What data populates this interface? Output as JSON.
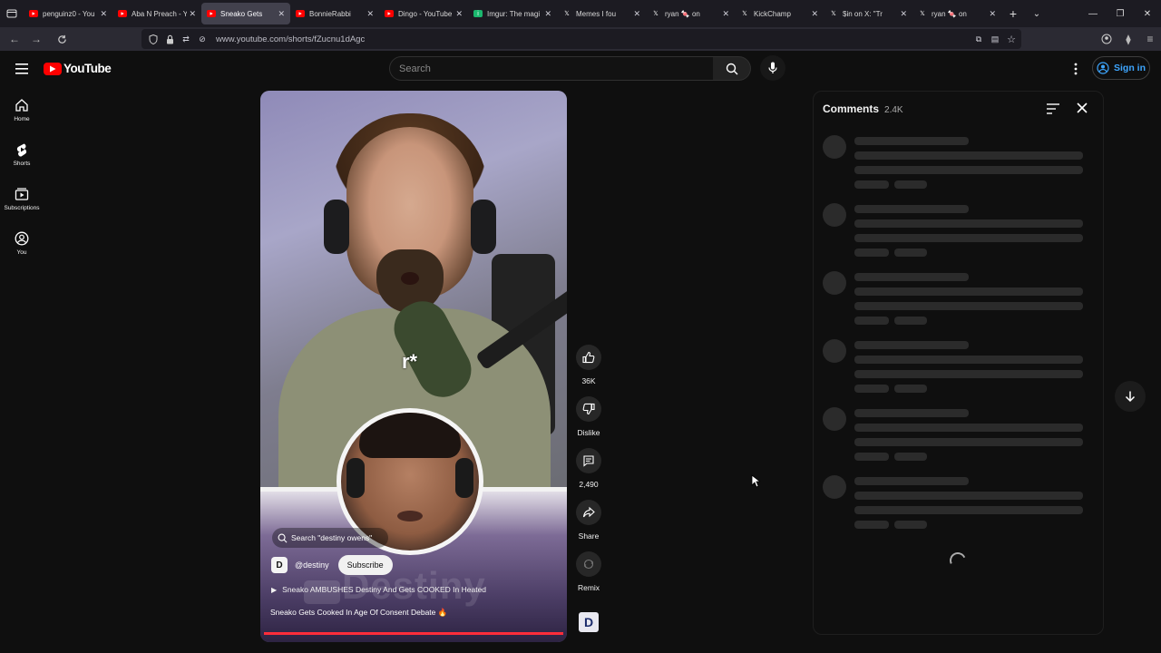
{
  "browser": {
    "tabs": [
      {
        "title": "penguinz0 - You",
        "fav": "yt",
        "active": false
      },
      {
        "title": "Aba N Preach - Y",
        "fav": "yt",
        "active": false
      },
      {
        "title": "Sneako Gets",
        "fav": "yt",
        "active": true
      },
      {
        "title": "BonnieRabbi",
        "fav": "yt",
        "active": false
      },
      {
        "title": "Dingo - YouTube",
        "fav": "yt",
        "active": false
      },
      {
        "title": "Imgur: The magi",
        "fav": "imgur",
        "active": false
      },
      {
        "title": "Memes I fou",
        "fav": "x",
        "active": false
      },
      {
        "title": "ryan 🍬 on",
        "fav": "x",
        "active": false
      },
      {
        "title": "KickChamp",
        "fav": "x",
        "active": false
      },
      {
        "title": "$in on X: \"Tr",
        "fav": "x",
        "active": false
      },
      {
        "title": "ryan 🍬 on",
        "fav": "x",
        "active": false
      }
    ],
    "url": "www.youtube.com/shorts/fZucnu1dAgc"
  },
  "header": {
    "logo_text": "YouTube",
    "search_placeholder": "Search",
    "signin_label": "Sign in"
  },
  "sidenav": [
    {
      "label": "Home",
      "icon": "home-icon"
    },
    {
      "label": "Shorts",
      "icon": "shorts-icon"
    },
    {
      "label": "Subscriptions",
      "icon": "subscriptions-icon"
    },
    {
      "label": "You",
      "icon": "you-icon"
    }
  ],
  "video": {
    "search_pill": "Search \"destiny owens\"",
    "channel": "@destiny",
    "subscribe_label": "Subscribe",
    "suggestion": "Sneako AMBUSHES Destiny And Gets COOKED In Heated",
    "title": "Sneako Gets Cooked In Age Of Consent Debate 🔥",
    "watermark": "Destiny",
    "progress_percent": 100
  },
  "actions": {
    "like_count": "36K",
    "dislike_label": "Dislike",
    "comments_count": "2,490",
    "share_label": "Share",
    "remix_label": "Remix"
  },
  "comments": {
    "title": "Comments",
    "count": "2.4K"
  },
  "colors": {
    "yt_red": "#ff0000",
    "link_blue": "#3ea6ff",
    "background": "#0f0f0f"
  }
}
